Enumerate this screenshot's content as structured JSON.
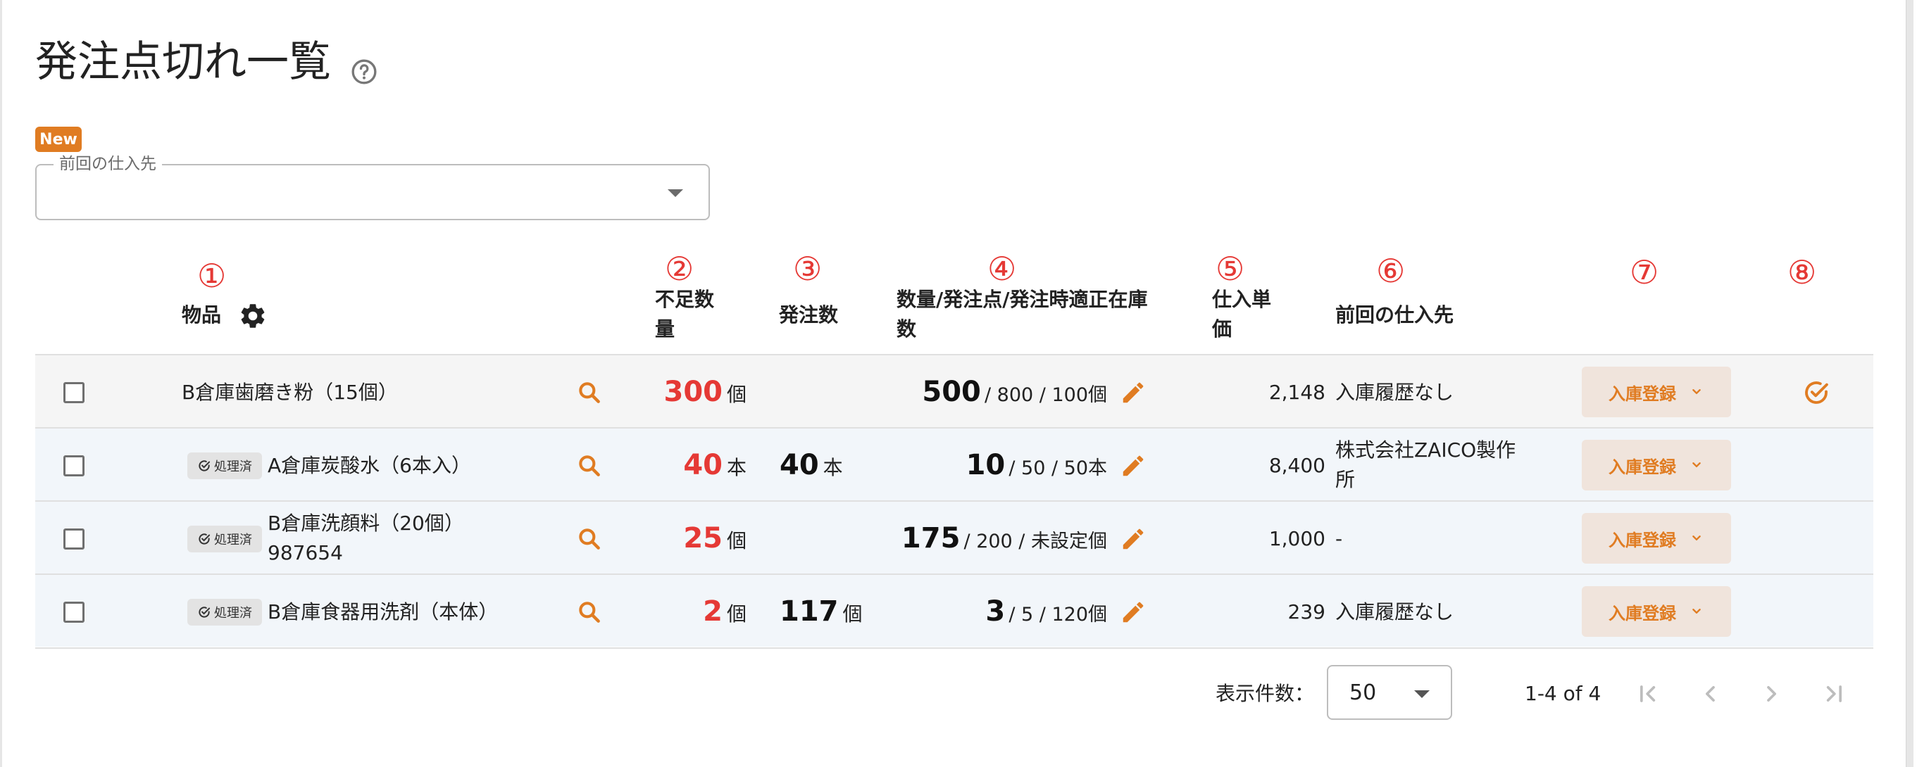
{
  "page": {
    "title": "発注点切れ一覧",
    "help_icon": "help-circle-icon"
  },
  "filter": {
    "new_badge": "New",
    "supplier_label": "前回の仕入先",
    "supplier_value": ""
  },
  "column_markers": [
    "①",
    "②",
    "③",
    "④",
    "⑤",
    "⑥",
    "⑦",
    "⑧"
  ],
  "columns": {
    "item": "物品",
    "shortage_line1": "不足数",
    "shortage_line2": "量",
    "order_qty": "発注数",
    "qty_line1": "数量/発注点/発注時適正在庫",
    "qty_line2": "数",
    "price_line1": "仕入単",
    "price_line2": "価",
    "last_supplier": "前回の仕入先"
  },
  "rows": [
    {
      "name": "B倉庫歯磨き粉（15個）",
      "processed": false,
      "shortage": "300",
      "shortage_unit": "個",
      "order_qty": "",
      "order_unit": "",
      "quantity": "500",
      "qty_rest": "/ 800 / 100個",
      "price": "2,148",
      "last_supplier": "入庫履歴なし",
      "action": "入庫登録",
      "done": true
    },
    {
      "name": "A倉庫炭酸水（6本入）",
      "processed": true,
      "shortage": "40",
      "shortage_unit": "本",
      "order_qty": "40",
      "order_unit": "本",
      "quantity": "10",
      "qty_rest": "/ 50 / 50本",
      "price": "8,400",
      "last_supplier_line1": "株式会社ZAICO製作",
      "last_supplier_line2": "所",
      "action": "入庫登録",
      "done": false
    },
    {
      "name": "B倉庫洗顔料（20個）",
      "name_line2": "987654",
      "processed": true,
      "shortage": "25",
      "shortage_unit": "個",
      "order_qty": "",
      "order_unit": "",
      "quantity": "175",
      "qty_rest": "/ 200 / 未設定個",
      "price": "1,000",
      "last_supplier": "-",
      "action": "入庫登録",
      "done": false
    },
    {
      "name": "B倉庫食器用洗剤（本体）",
      "processed": true,
      "shortage": "2",
      "shortage_unit": "個",
      "order_qty": "117",
      "order_unit": "個",
      "quantity": "3",
      "qty_rest": "/ 5 / 120個",
      "price": "239",
      "last_supplier": "入庫履歴なし",
      "action": "入庫登録",
      "done": false
    }
  ],
  "processed_badge": "処理済",
  "pagination": {
    "per_page_label": "表示件数：",
    "per_page_value": "50",
    "range": "1-4 of 4"
  },
  "icons": {
    "item_settings": "gear-icon",
    "row_search": "search-icon",
    "row_edit": "pencil-icon",
    "row_done": "check-circle-icon",
    "pager": [
      "first-page-icon",
      "prev-page-icon",
      "next-page-icon",
      "last-page-icon"
    ]
  },
  "colors": {
    "accent": "#e07c22",
    "marker_red": "#e53935",
    "stock_button_bg": "#f0e4dc",
    "first_row_bg": "#f5f5f5",
    "alt_row_bg": "#f2f6fa"
  }
}
